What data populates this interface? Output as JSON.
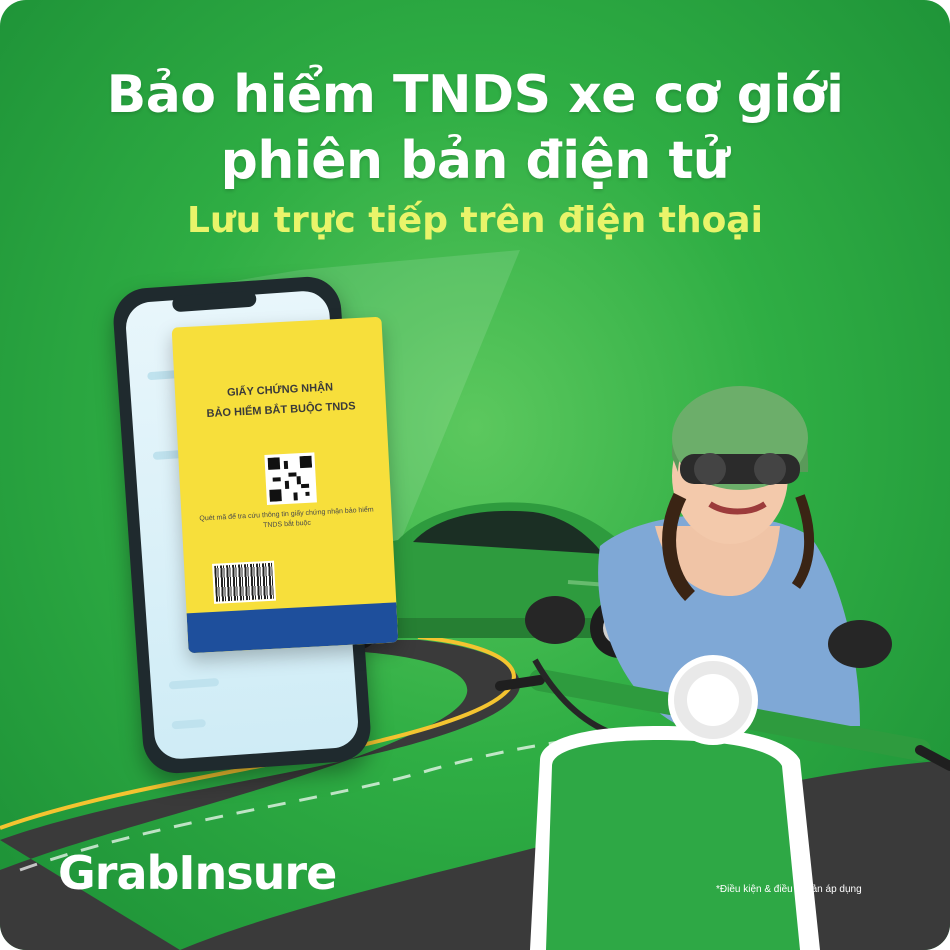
{
  "headline": {
    "line1": "Bảo hiểm TNDS xe cơ giới",
    "line2": "phiên bản điện tử"
  },
  "subheadline": "Lưu trực tiếp trên điện thoại",
  "certificate": {
    "title_line1": "GIẤY CHỨNG NHẬN",
    "title_line2": "BẢO HIỂM BẮT BUỘC TNDS",
    "description": "Quét mã để tra cứu thông tin giấy chứng nhận bảo hiểm TNDS bắt buộc"
  },
  "brand": "GrabInsure",
  "disclaimer": "*Điều kiện & điều khoản áp dụng",
  "colors": {
    "background": "#2fae44",
    "headline": "#ffffff",
    "subheadline": "#e9f46a",
    "certificate": "#f7df3b",
    "certificate_footer": "#1e4f9c",
    "car": "#2e9b3e",
    "road": "#3a3a3a"
  }
}
